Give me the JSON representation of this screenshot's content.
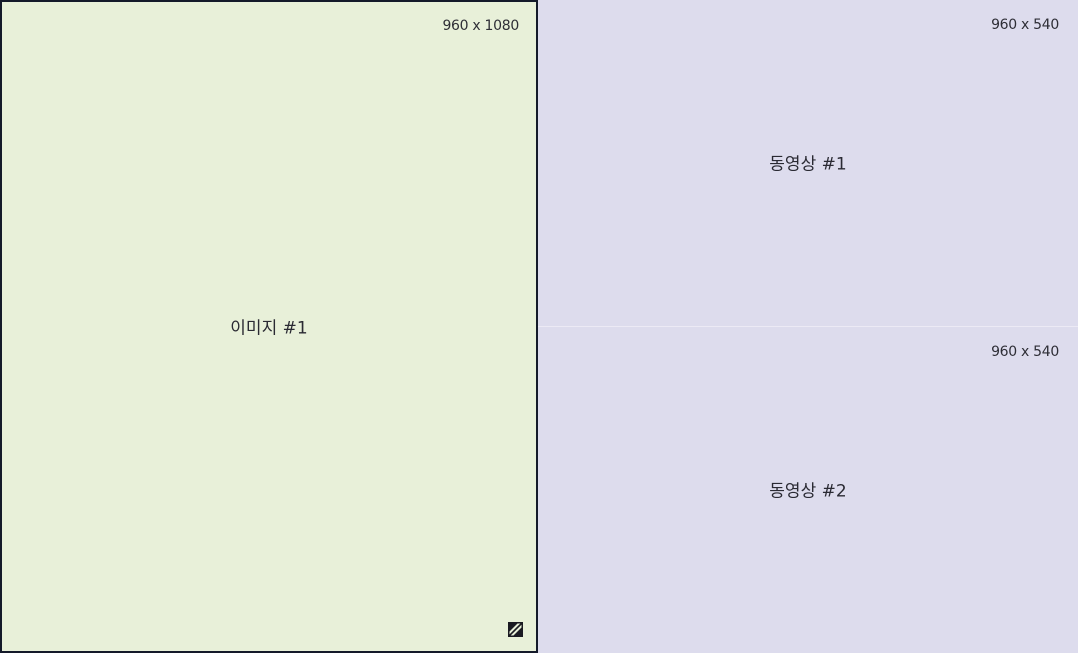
{
  "panels": {
    "image1": {
      "label": "이미지 #1",
      "dimensions": "960 x 1080",
      "background": "#e8f0d9",
      "border": "#141a2a",
      "selected": true
    },
    "video1": {
      "label": "동영상 #1",
      "dimensions": "960 x 540",
      "background": "#dddced"
    },
    "video2": {
      "label": "동영상 #2",
      "dimensions": "960 x 540",
      "background": "#dddced"
    }
  },
  "icons": {
    "image_corner": "resize-diagonal-icon"
  }
}
